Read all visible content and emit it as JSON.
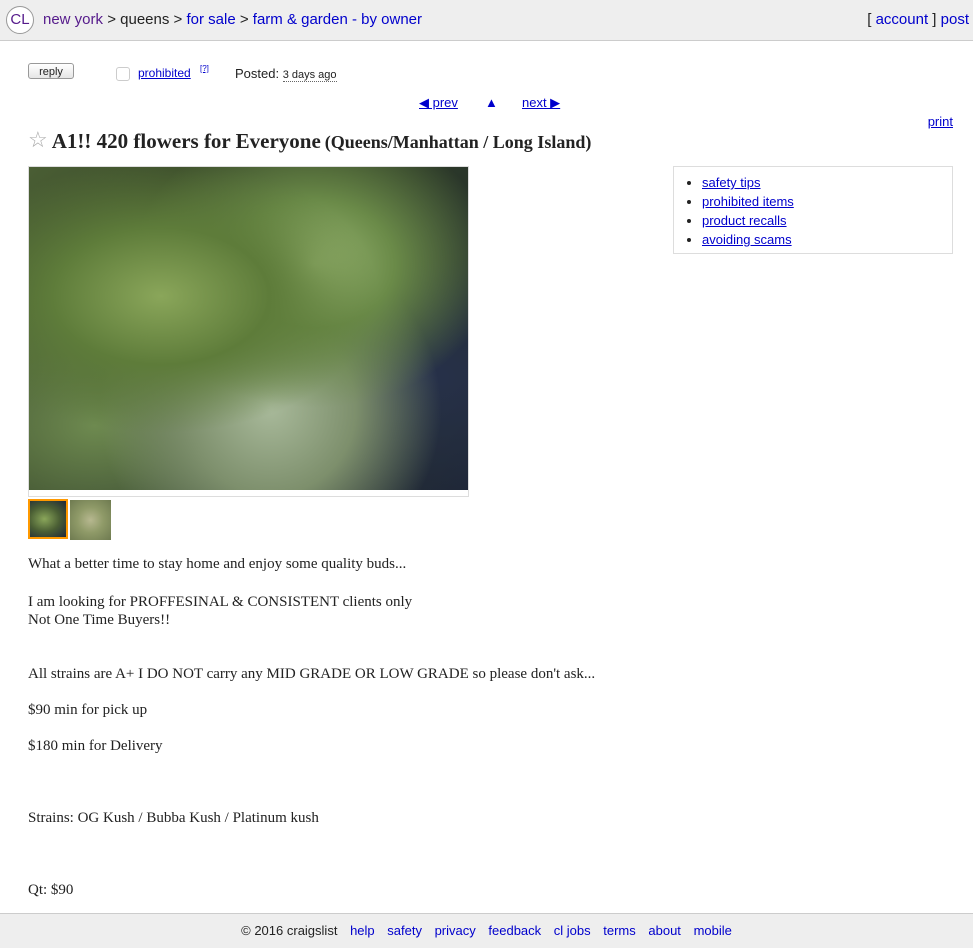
{
  "header": {
    "logo": "CL",
    "breadcrumbs": [
      "new york",
      "queens",
      "for sale",
      "farm & garden - by owner"
    ],
    "separator": ">",
    "account": "account",
    "post": "post"
  },
  "posting": {
    "reply_label": "reply",
    "prohibited_label": "prohibited",
    "prohibited_help": "[?]",
    "posted_label": "Posted:",
    "posted_date": "3 days ago",
    "prev_label": "◀ prev",
    "up_label": "▲",
    "next_label": "next ▶",
    "print_label": "print",
    "title": "A1!! 420 flowers for Everyone",
    "location": "(Queens/Manhattan / Long Island)",
    "star_icon": "☆"
  },
  "safety_links": [
    "safety tips",
    "prohibited items",
    "product recalls",
    "avoiding scams"
  ],
  "body": {
    "l1": "What a better time to stay home and enjoy some quality buds...",
    "l2": "I am looking for PROFFESINAL & CONSISTENT clients only",
    "l3": "Not One Time Buyers!!",
    "l4": "All strains are A+ I DO NOT carry any MID GRADE OR LOW GRADE so please don't ask...",
    "l5": "$90 min for pick up",
    "l6": "$180 min for Delivery",
    "l7": "Strains: OG Kush / Bubba Kush / Platinum kush",
    "l8": "Qt: $90"
  },
  "footer": {
    "copyright": "© 2016 craigslist",
    "links": [
      "help",
      "safety",
      "privacy",
      "feedback",
      "cl jobs",
      "terms",
      "about",
      "mobile"
    ]
  }
}
